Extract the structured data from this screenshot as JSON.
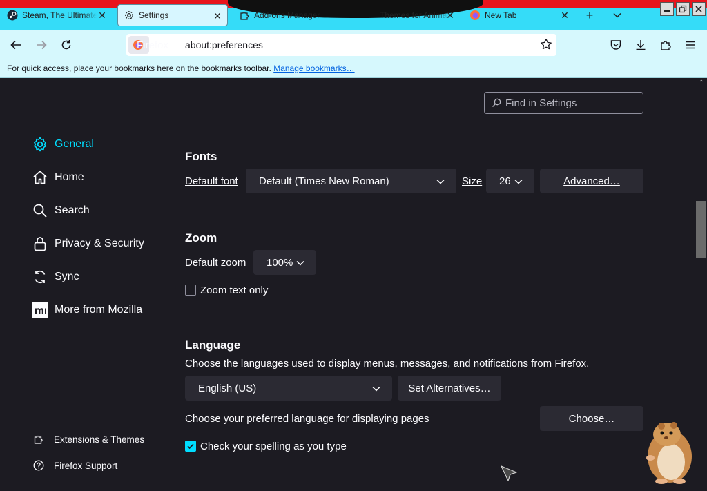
{
  "tabs": [
    {
      "title": "Steam, The Ultimate Online Game Platform",
      "icon": "steam-icon"
    },
    {
      "title": "Settings",
      "icon": "gear-icon",
      "active": true
    },
    {
      "title": "Add-ons Manager",
      "icon": "puzzle-icon"
    },
    {
      "title": "Themes for Animate",
      "icon": "firefox-icon"
    },
    {
      "title": "New Tab",
      "icon": "firefox-icon"
    }
  ],
  "nav": {
    "identity_label": "Firefox",
    "url": "about:preferences"
  },
  "bookmarks_bar": {
    "message": "For quick access, place your bookmarks here on the bookmarks toolbar.",
    "link": "Manage bookmarks…"
  },
  "search": {
    "placeholder": "Find in Settings"
  },
  "sidebar": {
    "items": [
      {
        "label": "General",
        "icon": "gear-icon",
        "active": true
      },
      {
        "label": "Home",
        "icon": "home-icon"
      },
      {
        "label": "Search",
        "icon": "search-icon"
      },
      {
        "label": "Privacy & Security",
        "icon": "lock-icon"
      },
      {
        "label": "Sync",
        "icon": "sync-icon"
      },
      {
        "label": "More from Mozilla",
        "icon": "mozilla-icon"
      }
    ],
    "footer": [
      {
        "label": "Extensions & Themes",
        "icon": "puzzle-icon"
      },
      {
        "label": "Firefox Support",
        "icon": "help-icon"
      }
    ]
  },
  "fonts": {
    "title": "Fonts",
    "default_font_label": "Default font",
    "default_font_value": "Default (Times New Roman)",
    "size_label": "Size",
    "size_value": "26",
    "advanced_button": "Advanced…"
  },
  "zoom": {
    "title": "Zoom",
    "default_zoom_label": "Default zoom",
    "default_zoom_value": "100%",
    "zoom_text_only_label": "Zoom text only",
    "zoom_text_only_checked": false
  },
  "language": {
    "title": "Language",
    "description": "Choose the languages used to display menus, messages, and notifications from Firefox.",
    "selected_language": "English (US)",
    "set_alternatives_button": "Set Alternatives…",
    "pages_description": "Choose your preferred language for displaying pages",
    "choose_button": "Choose…",
    "spellcheck_label": "Check your spelling as you type",
    "spellcheck_checked": true
  },
  "colors": {
    "accent": "#00ddff",
    "background": "#1c1b22",
    "control_bg": "#2b2a33",
    "theme_tabbar": "#35dcf8",
    "theme_stripe": "#e8141c"
  }
}
